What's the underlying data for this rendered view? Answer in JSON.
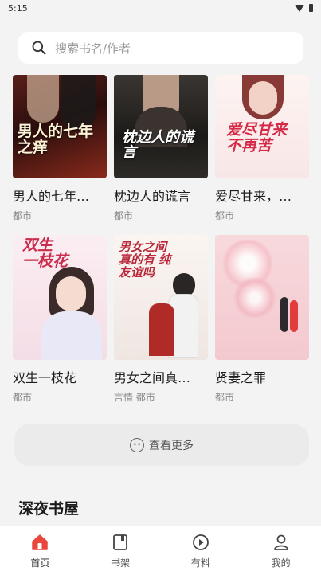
{
  "status_bar": {
    "time": "5:15"
  },
  "search": {
    "placeholder": "搜索书名/作者"
  },
  "books": [
    {
      "title": "男人的七年…",
      "tag": "都市",
      "cover_text": "男人的七年之痒"
    },
    {
      "title": "枕边人的谎言",
      "tag": "都市",
      "cover_text": "枕边人的谎言"
    },
    {
      "title": "爱尽甘来，…",
      "tag": "都市",
      "cover_text": "爱尽甘来 不再苦"
    },
    {
      "title": "双生一枝花",
      "tag": "都市",
      "cover_text": "双生 一枝花"
    },
    {
      "title": "男女之间真…",
      "tag": "言情 都市",
      "cover_text": "男女之间 真的有 纯友谊吗"
    },
    {
      "title": "贤妻之罪",
      "tag": "都市",
      "cover_text": ""
    }
  ],
  "more_button": {
    "label": "查看更多"
  },
  "section": {
    "title": "深夜书屋"
  },
  "tabs": [
    {
      "label": "首页",
      "icon": "home-icon"
    },
    {
      "label": "书架",
      "icon": "bookshelf-icon"
    },
    {
      "label": "有料",
      "icon": "play-icon"
    },
    {
      "label": "我的",
      "icon": "profile-icon"
    }
  ],
  "colors": {
    "accent": "#e9463d",
    "background": "#f3f3f3"
  }
}
